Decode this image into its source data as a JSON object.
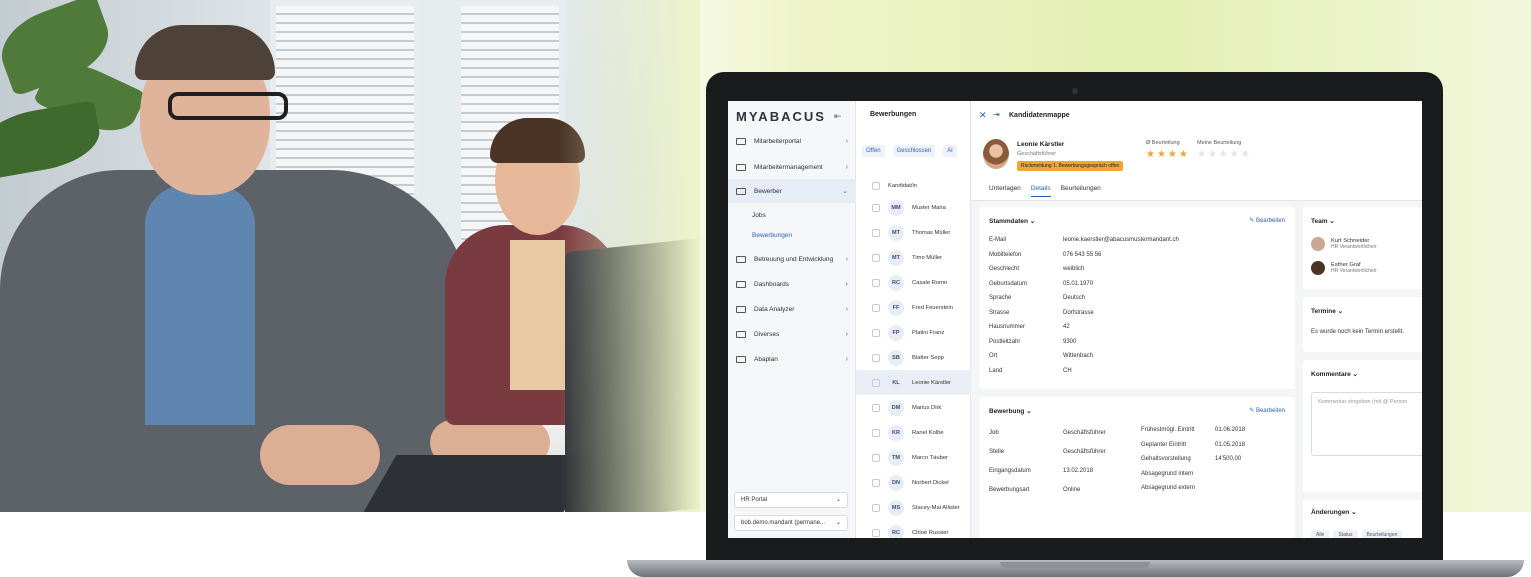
{
  "app": {
    "logo": "MYABACUS",
    "collapse_icon": "collapse-left-icon"
  },
  "sidebar": {
    "items": [
      {
        "label": "Mitarbeiterportal"
      },
      {
        "label": "Mitarbeitermanagement"
      },
      {
        "label": "Bewerber"
      },
      {
        "label": "Betreuung und Entwicklung"
      },
      {
        "label": "Dashboards"
      },
      {
        "label": "Data Analyzer"
      },
      {
        "label": "Diverses"
      },
      {
        "label": "Abaplan"
      }
    ],
    "sub_items": [
      {
        "label": "Jobs"
      },
      {
        "label": "Bewerbungen"
      }
    ],
    "portal_select": "HR Portal",
    "mandant_select": "bob.demo.mandant (permane..."
  },
  "list": {
    "title": "Bewerbungen",
    "tabs": [
      "Offen",
      "Geschlossen",
      "Al"
    ],
    "header": "Kandidat/in",
    "rows": [
      {
        "initials": "MM",
        "name": "Muster Maria"
      },
      {
        "initials": "MT",
        "name": "Thomas Müller"
      },
      {
        "initials": "MT",
        "name": "Timo Müller"
      },
      {
        "initials": "RC",
        "name": "Casale Romo"
      },
      {
        "initials": "FF",
        "name": "Fred Feuerstein"
      },
      {
        "initials": "FP",
        "name": "Platini Franz"
      },
      {
        "initials": "SB",
        "name": "Blatter Sepp"
      },
      {
        "initials": "KL",
        "name": "Leonie Kärstler"
      },
      {
        "initials": "DM",
        "name": "Marius Dirk"
      },
      {
        "initials": "KR",
        "name": "Ranel Kolbe"
      },
      {
        "initials": "TM",
        "name": "Marco Täuber"
      },
      {
        "initials": "DN",
        "name": "Norbert Dickel"
      },
      {
        "initials": "MS",
        "name": "Stacey-Mai Allister"
      },
      {
        "initials": "RC",
        "name": "Chloé Russier"
      }
    ]
  },
  "detail": {
    "title": "Kandidatenmappe",
    "candidate_name": "Leonie Kärstler",
    "candidate_role": "Geschäftsführer",
    "status_badge": "Rückmeldung 1. Bewerbungsgespräch offen",
    "avg_rating_label": "Ø Beurteilung",
    "my_rating_label": "Meine Beurteilung",
    "avg_stars": "★★★★",
    "my_stars": "★★★★★",
    "tabs": [
      "Unterlagen",
      "Details",
      "Beurteilungen"
    ],
    "stammdaten": {
      "title": "Stammdaten",
      "edit": "Bearbeiten",
      "fields": [
        {
          "k": "E-Mail",
          "v": "leonie.kaerstler@abacusmustermandant.ch"
        },
        {
          "k": "Mobiltelefon",
          "v": "076 543 55 56"
        },
        {
          "k": "Geschlecht",
          "v": "weiblich"
        },
        {
          "k": "Geburtsdatum",
          "v": "05.01.1970"
        },
        {
          "k": "Sprache",
          "v": "Deutsch"
        },
        {
          "k": "Strasse",
          "v": "Dorfstrasse"
        },
        {
          "k": "Hausnummer",
          "v": "42"
        },
        {
          "k": "Postleitzahl",
          "v": "9300"
        },
        {
          "k": "Ort",
          "v": "Wittenbach"
        },
        {
          "k": "Land",
          "v": "CH"
        }
      ]
    },
    "bewerbung": {
      "title": "Bewerbung",
      "edit": "Bearbeiten",
      "left": [
        {
          "k": "Job",
          "v": "Geschäftsführer"
        },
        {
          "k": "Stelle",
          "v": "Geschäftsführer"
        },
        {
          "k": "Eingangsdatum",
          "v": "13.02.2018"
        },
        {
          "k": "Bewerbungsart",
          "v": "Online"
        }
      ],
      "right": [
        {
          "k": "Frühestmögl. Eintritt",
          "v": "01.06.2018"
        },
        {
          "k": "Geplanter Eintritt",
          "v": "01.05.2018"
        },
        {
          "k": "Gehaltsvorstellung",
          "v": "14'500.00"
        },
        {
          "k": "Absagegrund intern",
          "v": ""
        },
        {
          "k": "Absagegrund extern",
          "v": ""
        }
      ]
    },
    "team": {
      "title": "Team",
      "members": [
        {
          "name": "Kurt Schneider",
          "role": "HR Verantwortliche/r"
        },
        {
          "name": "Esther Graf",
          "role": "HR Verantwortliche/r"
        }
      ]
    },
    "termine": {
      "title": "Termine",
      "empty": "Es wurde noch kein Termin erstellt."
    },
    "kommentare": {
      "title": "Kommentare",
      "placeholder": "Kommentar eingeben (mit @ Person"
    },
    "aenderungen": {
      "title": "Änderungen",
      "chips": [
        "Alle",
        "Status",
        "Beurteilungen"
      ]
    }
  }
}
